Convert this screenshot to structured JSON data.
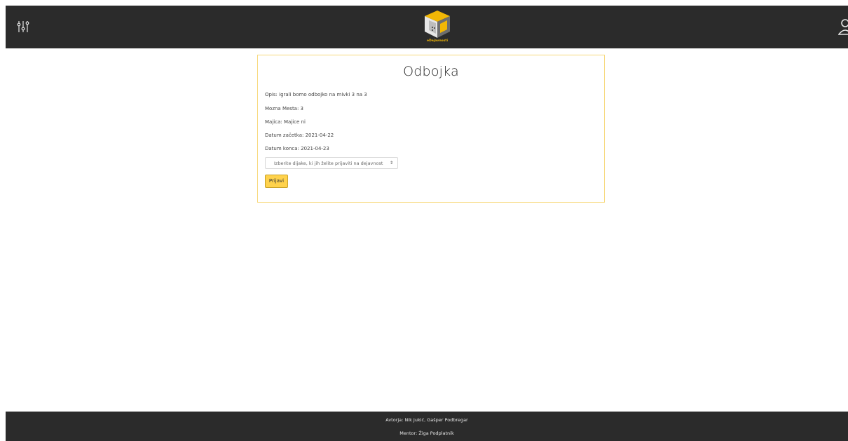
{
  "header": {
    "logo_text": "eDejavnosti"
  },
  "activity": {
    "title": "Odbojka",
    "description": "Opis: igrali bomo odbojko na mivki 3 na 3",
    "places": "Mozna Mesta: 3",
    "shirts": "Majica: Majice ni",
    "start_date": "Datum začetka: 2021-04-22",
    "end_date": "Datum konca: 2021-04-23",
    "select_placeholder": "Izberite dijake, ki jih želite prijaviti na dejavnost",
    "submit_label": "Prijavi"
  },
  "footer": {
    "authors": "Avtorja: Nik Jukić, Gašper Podbregar",
    "mentor": "Mentor: Žiga Podplatnik"
  },
  "colors": {
    "header_bg": "#2b2b2b",
    "accent": "#ffd24c",
    "card_border": "#f7d87a"
  },
  "icons": {
    "menu": "filter-sliders-icon",
    "account": "user-icon",
    "logo": "cube-logo-icon"
  }
}
